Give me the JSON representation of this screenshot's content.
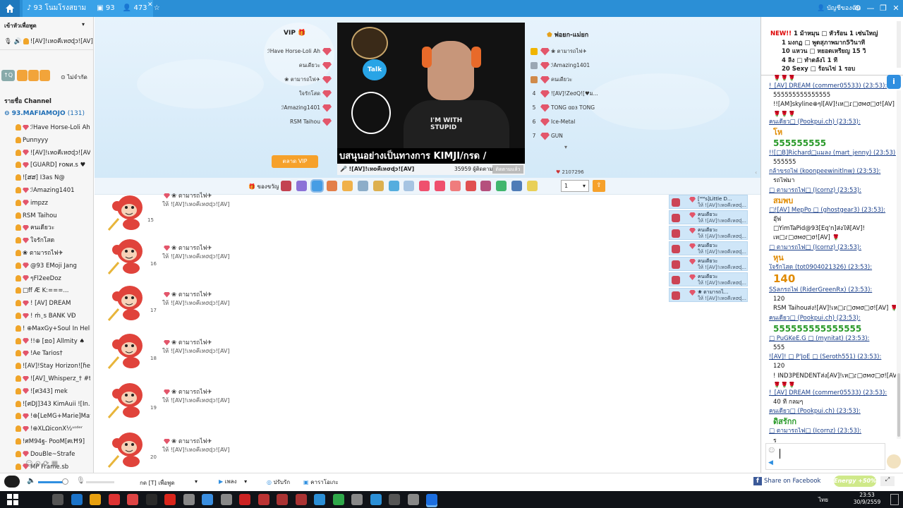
{
  "topbar": {
    "home_icon": "home-icon",
    "room": "♪ 93 โนมโรงสยาม",
    "count_cams": "93",
    "count_users": "473",
    "account": "บัญชีของฉัน"
  },
  "left": {
    "header": "เข้าหัวเพื่อพูด",
    "speaker": "![AV]!เหoคีเหσɖɔ![AV]",
    "mute_label": "ไม่จำกัด",
    "channel_title": "รายชื่อ Channel",
    "channel_name": "93.MAFIAMOJO",
    "channel_count": "(131)",
    "users": [
      "ℐHave Horse-Loli Ah",
      "Punnyyy",
      "![AV]!เหoคีเหσɖɔ![AV]",
      "[GUARD] ꜰᴏɴᴎ.s ♥",
      "![ສສ] I3as N@",
      "ℐAmazing1401",
      "impzz",
      "RSM Taihou",
      "คนเดียวะ",
      "ใจรักโสด",
      "❀ ตามารถไฟ✈",
      "@93 EMoji Jang",
      "ๆFl2eeDoz",
      "□ff  Æ  K:===...",
      "!  [AV] DREAM",
      "! ḿ˛s  BANK  VÐ",
      "! ⊕MaxGy+Soul In Hell !",
      "!!⊕ [ຂ໐] Allmity ♠",
      "!Ae Tarios†",
      "![AV]!Stay Horizon![ɦe...",
      "![AV]_Whisperz_† #t...",
      "![ศ343] mek",
      "![ศDJ]343 KimAuii ![In...",
      "!⊕[LeMG+Marie]May",
      "!⊕XLΩiconX½ᵘᶦᵈᵉʳ",
      "!ศM94ฐ- PooM[ศιĦ9]",
      "DouBle~Strafe",
      "MP Frame.sb"
    ]
  },
  "vip": {
    "title": "VIP",
    "list": [
      "ℐHave Horse-Loli Ah",
      "คนเดียวะ",
      "❀ ตามารถไฟ✈",
      "ใจรักโสด",
      "ℐAmazing1401",
      "RSM Taihou"
    ],
    "button": "ตลาด VIP"
  },
  "leaderboard": {
    "title": "พ่อยก-แม่ยก",
    "rows": [
      {
        "rank": "",
        "name": "❀ ตามารถไฟ✈"
      },
      {
        "rank": "",
        "name": "ℐAmazing1401"
      },
      {
        "rank": "",
        "name": "คนเดียวะ"
      },
      {
        "rank": "4",
        "name": "![AV]!ZeσQ![♥ม..."
      },
      {
        "rank": "5",
        "name": "TONG ɑɒɜ TONG"
      },
      {
        "rank": "6",
        "name": "Ice-Metal"
      },
      {
        "rank": "7",
        "name": "GUN"
      }
    ],
    "heart_count": "2107296"
  },
  "video": {
    "caption": "บสนุนอย่างเป็นทางการ KIMJI/กรด /",
    "streamer": "![AV]!เหoคีเหσɖɔ![AV]",
    "viewers": "35959 ผู้ติดตาม",
    "follow_btn": "ติดตามแล้ว",
    "shirt_text": "I'M WITH STUPID"
  },
  "giftbar": {
    "label": "ของขวัญ",
    "qty": "1"
  },
  "posts": [
    {
      "name": "❀ ตามารถไฟ✈",
      "sub": "ให้ ![AV]!เหoคีเหσɖɔ![AV]",
      "num": "15"
    },
    {
      "name": "❀ ตามารถไฟ✈",
      "sub": "ให้ ![AV]!เหoคีเหσɖɔ![AV]",
      "num": "16"
    },
    {
      "name": "❀ ตามารถไฟ✈",
      "sub": "ให้ ![AV]!เหoคีเหσɖɔ![AV]",
      "num": "17"
    },
    {
      "name": "❀ ตามารถไฟ✈",
      "sub": "ให้ ![AV]!เหoคีเหσɖɔ![AV]",
      "num": "18"
    },
    {
      "name": "❀ ตามารถไฟ✈",
      "sub": "ให้ ![AV]!เหoคีเหσɖɔ![AV]",
      "num": "19"
    },
    {
      "name": "❀ ตามารถไฟ✈",
      "sub": "ให้ ![AV]!เหoคีเหσɖɔ![AV]",
      "num": "20"
    }
  ],
  "recent": [
    {
      "name": "[ᴹᴹs]Little D...",
      "sub": "ให้ ![AV]!เหoคีเหσɖ..."
    },
    {
      "name": "คนเดียวะ",
      "sub": "ให้ ![AV]!เหoคีเหσɖ..."
    },
    {
      "name": "คนเดียวะ",
      "sub": "ให้ ![AV]!เหoคีเหσɖ..."
    },
    {
      "name": "คนเดียวะ",
      "sub": "ให้ ![AV]!เหoคีเหσɖ..."
    },
    {
      "name": "คนเดียวะ",
      "sub": "ให้ ![AV]!เหoคีเหσɖ..."
    },
    {
      "name": "คนเดียวะ",
      "sub": "ให้ ![AV]!เหoคีเหσɖ..."
    },
    {
      "name": "❀ ตามารถไ...",
      "sub": "ให้ ![AV]!เหoคีเหσɖ..."
    }
  ],
  "chat_top": [
    "NEW!!  1 ม้าหมุน  □  หัวร้อน 1 เซ่นใหญ่",
    "1   มงกฏ  □  พูดสุภาพมาก5วินาที",
    "10 แหวน  □  หยอดเหรียญ 15 วิ",
    "4 ลิ่ง  □  ทำตลังไ 1 ที",
    "20 Sexy  □  ร้อนไข่ 1 รอบ"
  ],
  "chat": [
    "🌹🌹🌹",
    "!_[AV] DREAM (commer05533) (23:53):",
    "555555555555555",
    "!![AM]skyline⊕ๆl[AV]!เห□ɾ□σмσ□σ![AV]",
    "🌹🌹🌹",
    "คนเดียว□ (Pookpui.ch) (23:53):",
    "โห",
    "555555555",
    "!![□B]Richard□แมลง (mart_jenny) (23:53):",
    "555555",
    "กล้าขรถไฟ (koonpeewinitlnw) (23:53):",
    "รถไฟมา",
    "□ ตามารถไฟ□ (Icornz) (23:53):",
    "สมพบ",
    "□![AV] MepPo □ (ghostgear3) (23:53):",
    "อุ๊ฟ",
    "□YimTaPid@93[Eq'n]ส่งให้[AV]!",
    "เห□ɾ□σмσ□σ![AV] 🌹",
    "□ ตามารถไฟ□ (Icornz) (23:53):",
    "หุน",
    "ใจรักโสด (tot0904021326) (23:53):",
    "140",
    "SSลกรถไฟ (RiderGreenRx) (23:53):",
    "120",
    "RSM Taihouส่ง![AV]!เห□ɾ□σмσ□σ![AV] 🌹",
    "คนเดียว□ (Pookpui.ch) (23:53):",
    "555555555555555",
    "□ PuGKeE.G □ (mynitat) (23:53):",
    "555",
    "![AV]! □ P'JoE □ (Seroth551) (23:53):",
    "120",
    "!  IND3PENDENTส่ง[AV]!เห□ɾ□σмσ□σ![AV]",
    "🌹🌹🌹",
    "!_[AV] DREAM (commer05533) (23:53):",
    "40 ที่ กลมๆ",
    "คนเดียว□ (Pookpui.ch) (23:53):",
    "ดิสรักก",
    "□ ตามารถไฟ□ (Icornz) (23:53):",
    "ร"
  ],
  "bottom": {
    "mic_label": "กด [T] เพื่อพูด",
    "music": "เพลง",
    "broadcast": "ปรับรัก",
    "karaoke": "คาราโอเกะ",
    "share": "Share on Facebook",
    "energy": "Energy +50%"
  },
  "taskbar": {
    "time": "23:53",
    "date": "30/9/2559",
    "lang": "ไทย"
  }
}
